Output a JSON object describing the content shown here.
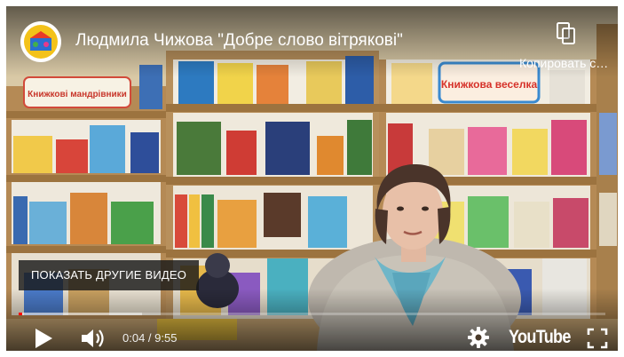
{
  "player": {
    "title": "Людмила Чижова \"Добре слово вітрякові\"",
    "copy_label": "Копировать ссылку",
    "more_videos_label": "ПОКАЗАТЬ ДРУГИЕ ВИДЕО",
    "current_time": "0:04",
    "duration": "9:55",
    "time_separator": " / ",
    "progress_fraction": 0.0067,
    "buffered_fraction": 0.21,
    "brand_label": "YouTube",
    "accent_color": "#ff0000"
  },
  "video_frame": {
    "shelf_signs": [
      "Книжкові мандрівники",
      "Книжкова веселка"
    ],
    "icons": [
      "channel-logo",
      "copy-link-icon",
      "play-icon",
      "volume-icon",
      "gear-icon",
      "fullscreen-icon"
    ]
  }
}
